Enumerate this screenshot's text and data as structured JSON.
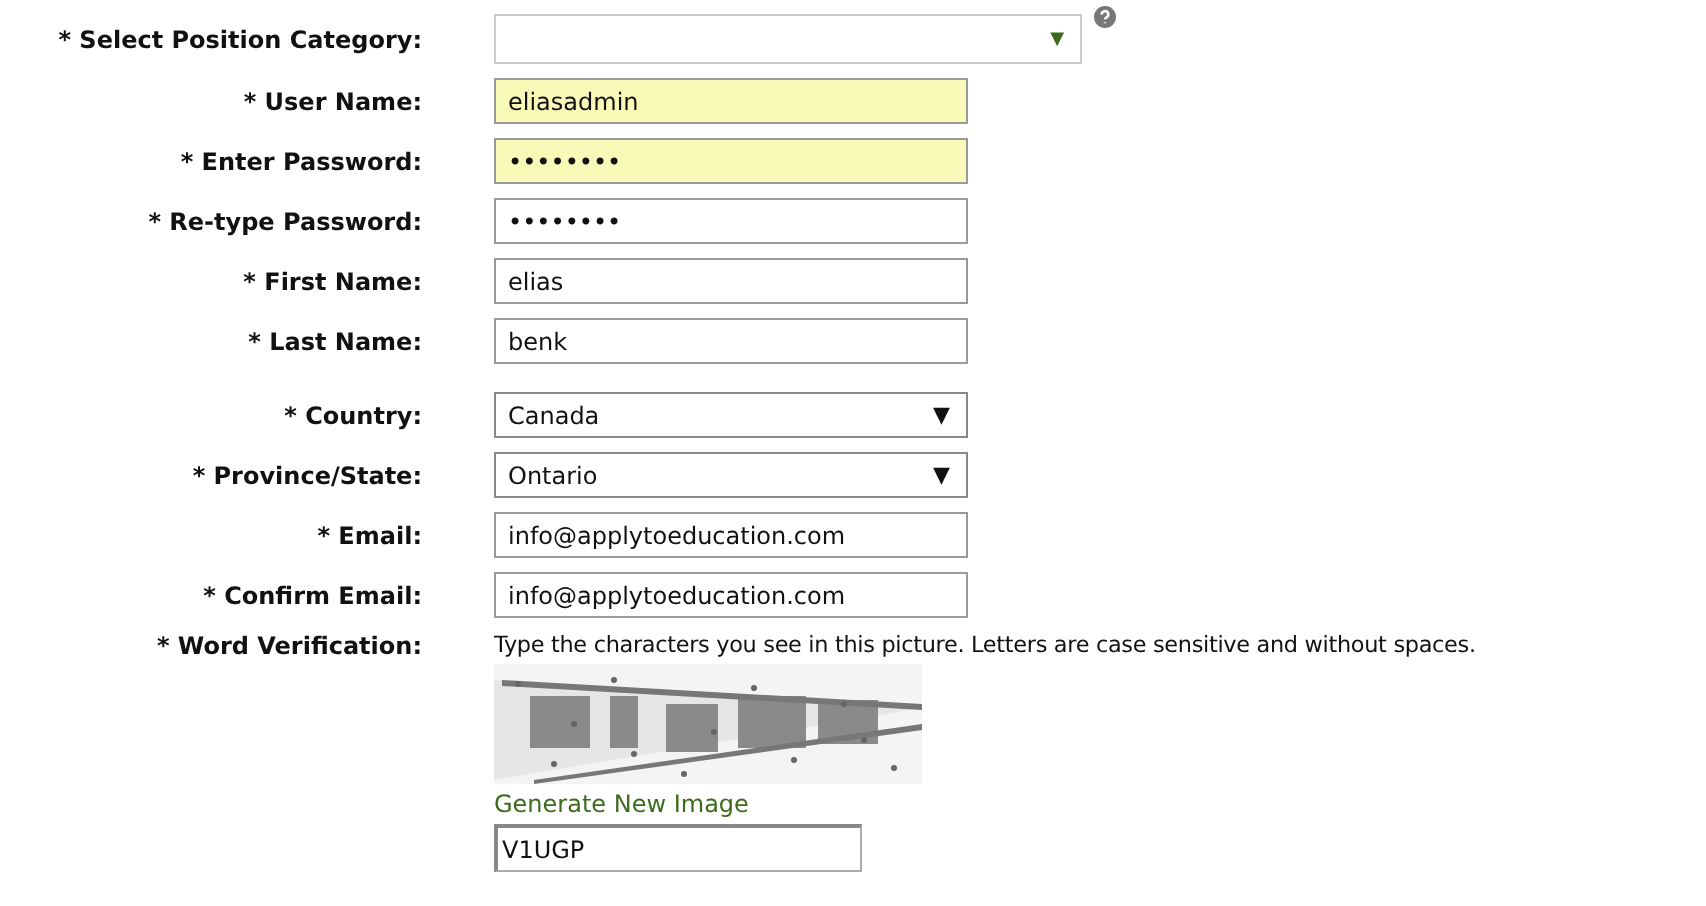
{
  "fields": [
    {
      "label": "* Select Position Category:",
      "kind": "dropdown",
      "help": true,
      "caret": "▼"
    },
    {
      "label": "* User Name:",
      "kind": "text",
      "value": "eliasadmin",
      "autofilled": true
    },
    {
      "label": "* Enter Password:",
      "kind": "text",
      "value": "••••••••",
      "autofilled": true
    },
    {
      "label": "* Re-type Password:",
      "kind": "text",
      "value": "••••••••",
      "autofilled": false
    },
    {
      "label": "* First Name:",
      "kind": "text",
      "value": "elias",
      "autofilled": false
    },
    {
      "label": "* Last Name:",
      "kind": "text",
      "value": "benk",
      "autofilled": false
    },
    {
      "label": "* Country:",
      "kind": "select",
      "value": "Canada",
      "caret": "▼"
    },
    {
      "label": "* Province/State:",
      "kind": "select",
      "value": "Ontario",
      "caret": "▼"
    },
    {
      "label": "* Email:",
      "kind": "text",
      "value": "info@applytoeducation.com",
      "autofilled": false
    },
    {
      "label": "* Confirm Email:",
      "kind": "text",
      "value": "info@applytoeducation.com",
      "autofilled": false
    }
  ],
  "verification": {
    "label": "* Word Verification:",
    "instruction": "Type the characters you see in this picture. Letters are case sensitive and without spaces.",
    "link": "Generate New Image",
    "value": "V1UGP"
  }
}
